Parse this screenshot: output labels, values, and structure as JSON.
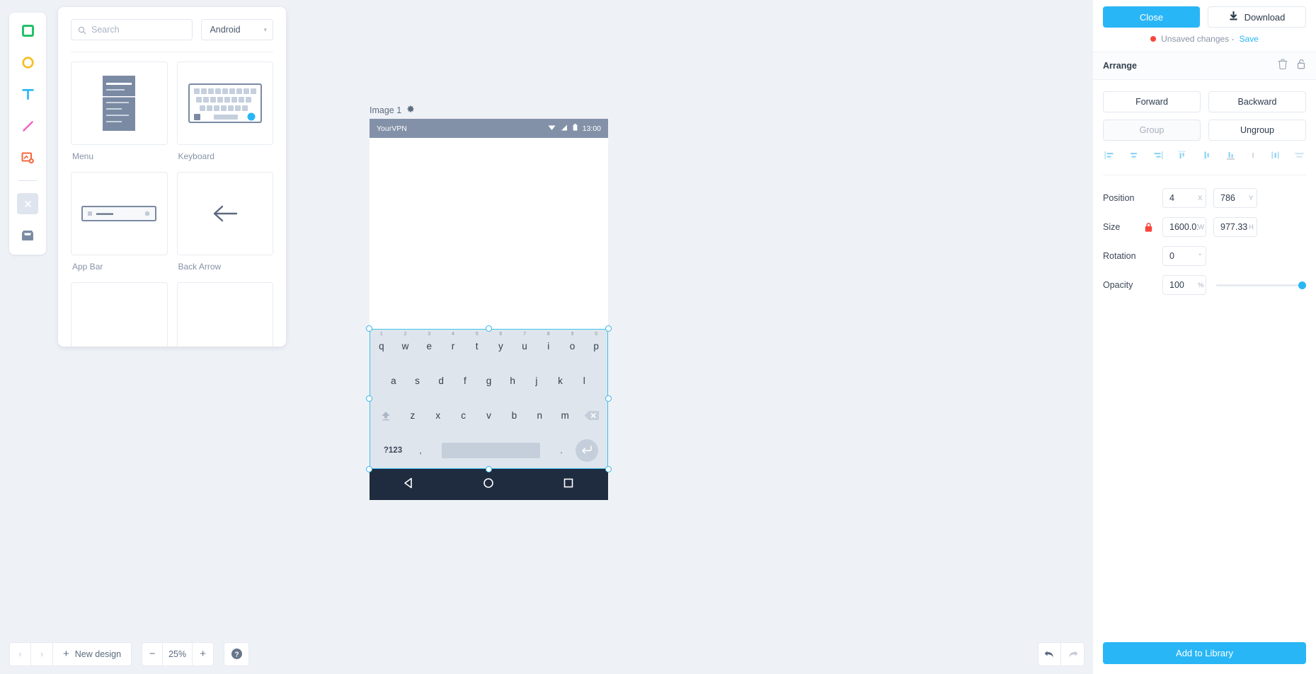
{
  "toolbar": {
    "items": [
      {
        "name": "rectangle-tool",
        "color": "#23c268"
      },
      {
        "name": "ellipse-tool",
        "color": "#f5c026"
      },
      {
        "name": "text-tool",
        "color": "#29b6f6"
      },
      {
        "name": "line-tool",
        "color": "#ef68c4"
      },
      {
        "name": "image-add-tool",
        "color": "#f4673b"
      },
      {
        "name": "close-tool",
        "color": "#ffffff"
      },
      {
        "name": "inbox-tool",
        "color": "#7b8ba3"
      }
    ]
  },
  "panel": {
    "search": {
      "value": "",
      "placeholder": "Search"
    },
    "platform": {
      "selected": "Android",
      "caret": "▾"
    },
    "components": [
      {
        "label": "Menu",
        "thumb": "menu"
      },
      {
        "label": "Keyboard",
        "thumb": "keyboard"
      },
      {
        "label": "App Bar",
        "thumb": "appbar"
      },
      {
        "label": "Back Arrow",
        "thumb": "backarrow"
      },
      {
        "label": "",
        "thumb": "blank"
      },
      {
        "label": "",
        "thumb": "blank"
      }
    ]
  },
  "canvas": {
    "artboard_label": "Image 1",
    "phone": {
      "statusbar": {
        "carrier": "YourVPN",
        "time": "13:00"
      },
      "keyboard": {
        "row1": [
          {
            "key": "q",
            "num": "1"
          },
          {
            "key": "w",
            "num": "2"
          },
          {
            "key": "e",
            "num": "3"
          },
          {
            "key": "r",
            "num": "4"
          },
          {
            "key": "t",
            "num": "5"
          },
          {
            "key": "y",
            "num": "6"
          },
          {
            "key": "u",
            "num": "7"
          },
          {
            "key": "i",
            "num": "8"
          },
          {
            "key": "o",
            "num": "9"
          },
          {
            "key": "p",
            "num": "0"
          }
        ],
        "row2": [
          "a",
          "s",
          "d",
          "f",
          "g",
          "h",
          "j",
          "k",
          "l"
        ],
        "row3": [
          "z",
          "x",
          "c",
          "v",
          "b",
          "n",
          "m"
        ],
        "row4": {
          "symbols": "?123",
          "comma": ",",
          "period": "."
        }
      }
    }
  },
  "bottombar": {
    "prev": "‹",
    "next": "›",
    "new_design": "New design",
    "zoom_out": "−",
    "zoom_value": "25%",
    "zoom_in": "+",
    "help": "?"
  },
  "right": {
    "close_label": "Close",
    "download_label": "Download",
    "unsaved_text": "Unsaved changes -",
    "save_label": "Save",
    "arrange_title": "Arrange",
    "forward_label": "Forward",
    "backward_label": "Backward",
    "group_label": "Group",
    "ungroup_label": "Ungroup",
    "properties": {
      "position_label": "Position",
      "position_x": "4",
      "position_x_unit": "X",
      "position_y": "786",
      "position_y_unit": "Y",
      "size_label": "Size",
      "size_w": "1600.01",
      "size_w_unit": "W",
      "size_h": "977.33",
      "size_h_unit": "H",
      "rotation_label": "Rotation",
      "rotation_value": "0",
      "rotation_unit": "°",
      "opacity_label": "Opacity",
      "opacity_value": "100",
      "opacity_unit": "%"
    },
    "add_library_label": "Add to Library"
  },
  "colors": {
    "accent": "#29b6f6",
    "danger": "#f8453b",
    "statusbar": "#8391a8",
    "navbar": "#1f2b3e",
    "selection": "#37b6e8"
  }
}
